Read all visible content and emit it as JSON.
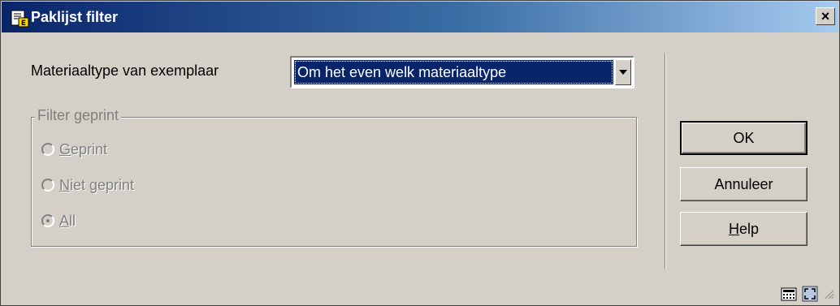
{
  "window": {
    "title": "Paklijst filter",
    "close_label": "×"
  },
  "form": {
    "material_type_label": "Materiaaltype van exemplaar",
    "material_type_selected": "Om het even welk materiaaltype"
  },
  "filter_group": {
    "legend": "Filter geprint",
    "options": [
      {
        "label_hot": "G",
        "label_rest": "eprint",
        "checked": false,
        "enabled": false
      },
      {
        "label_hot": "N",
        "label_rest": "iet geprint",
        "checked": false,
        "enabled": false
      },
      {
        "label_hot": "A",
        "label_rest": "ll",
        "checked": true,
        "enabled": false
      }
    ]
  },
  "buttons": {
    "ok": "OK",
    "cancel": "Annuleer",
    "help_hot": "H",
    "help_rest": "elp"
  },
  "icons": {
    "title": "report-filter-icon",
    "status_left": "calculator-icon",
    "status_right": "expand-icon",
    "dropdown": "chevron-down-icon",
    "close": "close-icon"
  }
}
